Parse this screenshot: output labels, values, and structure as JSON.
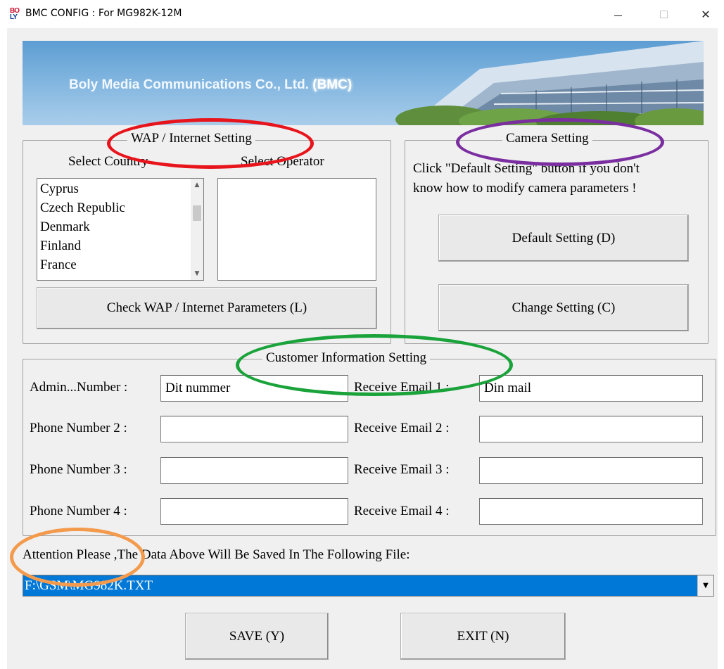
{
  "window": {
    "title": "BMC CONFIG : For MG982K-12M",
    "app_icon_top": "BO",
    "app_icon_bottom": "LY",
    "close_glyph": "✕"
  },
  "banner": {
    "company": "Boly Media Communications Co., Ltd.",
    "abbr": "(BMC)"
  },
  "wap": {
    "legend": "WAP / Internet Setting",
    "country_label": "Select Country",
    "operator_label": "Select Operator",
    "countries": [
      "Cyprus",
      "Czech Republic",
      "Denmark",
      "Finland",
      "France"
    ],
    "scroll_up_glyph": "▲",
    "scroll_down_glyph": "▼",
    "check_button": "Check WAP / Internet Parameters (L)"
  },
  "camera": {
    "legend": "Camera Setting",
    "hint_line1": "Click \"Default Setting\" button if you don't",
    "hint_line2": "know how to modify camera parameters !",
    "default_button": "Default Setting (D)",
    "change_button": "Change Setting (C)"
  },
  "customer": {
    "legend": "Customer Information Setting",
    "phones": [
      {
        "label": "Admin...Number :",
        "value": "Dit nummer"
      },
      {
        "label": "Phone Number 2 :",
        "value": ""
      },
      {
        "label": "Phone Number 3 :",
        "value": ""
      },
      {
        "label": "Phone Number 4 :",
        "value": ""
      }
    ],
    "emails": [
      {
        "label": "Receive Email 1 :",
        "value": "Din mail"
      },
      {
        "label": "Receive Email 2 :",
        "value": ""
      },
      {
        "label": "Receive Email 3 :",
        "value": ""
      },
      {
        "label": "Receive Email 4 :",
        "value": ""
      }
    ]
  },
  "file": {
    "attention": "Attention Please ,The Data Above Will Be Saved In The Following  File:",
    "path": "F:\\GSM\\MG982K.TXT",
    "dropdown_glyph": "▼"
  },
  "actions": {
    "save": "SAVE (Y)",
    "exit": "EXIT (N)"
  },
  "annotation_colors": {
    "red": "#e8141c",
    "purple": "#7a2ea0",
    "green": "#1aa33a",
    "orange": "#f39a4c"
  },
  "selection_color": "#0078d7"
}
